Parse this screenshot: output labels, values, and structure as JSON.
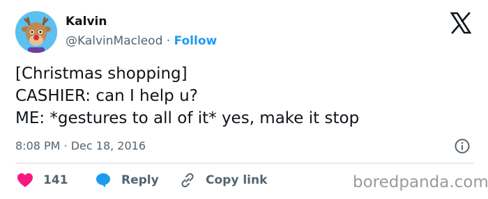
{
  "author": {
    "name": "Kalvin",
    "handle": "@KalvinMacleod",
    "separator": "·",
    "follow_label": "Follow"
  },
  "tweet": {
    "lines": [
      "[Christmas shopping]",
      "CASHIER: can I help u?",
      "ME: *gestures to all of it* yes, make it stop"
    ],
    "timestamp": "8:08 PM · Dec 18, 2016"
  },
  "actions": {
    "likes_count": "141",
    "reply_label": "Reply",
    "copy_link_label": "Copy link"
  },
  "watermark": "boredpanda.com",
  "colors": {
    "like": "#f91880",
    "reply": "#1d9bf0",
    "link": "#1d9bf0",
    "muted": "#536471",
    "text": "#0f1419"
  },
  "icons": [
    "avatar-reindeer",
    "x-logo-icon",
    "info-icon",
    "heart-icon",
    "reply-bubble-icon",
    "link-icon"
  ]
}
